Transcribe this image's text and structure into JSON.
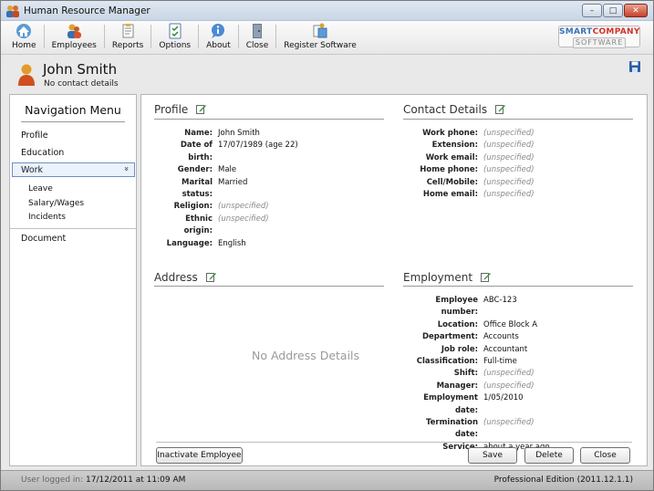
{
  "window": {
    "title": "Human Resource Manager",
    "minimize": "–",
    "maximize": "□",
    "close": "✕"
  },
  "toolbar": {
    "items": [
      {
        "label": "Home",
        "icon": "home-icon"
      },
      {
        "label": "Employees",
        "icon": "employees-icon"
      },
      {
        "label": "Reports",
        "icon": "reports-icon"
      },
      {
        "label": "Options",
        "icon": "options-icon"
      },
      {
        "label": "About",
        "icon": "about-icon"
      },
      {
        "label": "Close",
        "icon": "close-door-icon"
      },
      {
        "label": "Register Software",
        "icon": "register-icon"
      }
    ],
    "logo_smart": "SMART",
    "logo_company": "COMPANY",
    "logo_software": "SOFTWARE"
  },
  "person": {
    "name": "John Smith",
    "subtitle": "No contact details"
  },
  "nav": {
    "title": "Navigation Menu",
    "items": [
      "Profile",
      "Education",
      "Work",
      "Document"
    ],
    "selected": "Work",
    "sub_items": [
      "Leave",
      "Salary/Wages",
      "Incidents"
    ],
    "chevron": "»"
  },
  "profile": {
    "title": "Profile",
    "fields": [
      {
        "label": "Name:",
        "value": "John Smith"
      },
      {
        "label": "Date of birth:",
        "value": "17/07/1989 (age 22)"
      },
      {
        "label": "Gender:",
        "value": "Male"
      },
      {
        "label": "Marital status:",
        "value": "Married"
      },
      {
        "label": "Religion:",
        "value": "(unspecified)"
      },
      {
        "label": "Ethnic origin:",
        "value": "(unspecified)"
      },
      {
        "label": "Language:",
        "value": "English"
      }
    ]
  },
  "contact": {
    "title": "Contact Details",
    "fields": [
      {
        "label": "Work phone:",
        "value": "(unspecified)"
      },
      {
        "label": "Extension:",
        "value": "(unspecified)"
      },
      {
        "label": "Work email:",
        "value": "(unspecified)"
      },
      {
        "label": "Home phone:",
        "value": "(unspecified)"
      },
      {
        "label": "Cell/Mobile:",
        "value": "(unspecified)"
      },
      {
        "label": "Home email:",
        "value": "(unspecified)"
      }
    ]
  },
  "address": {
    "title": "Address",
    "empty_text": "No Address Details"
  },
  "employment": {
    "title": "Employment",
    "fields": [
      {
        "label": "Employee number:",
        "value": "ABC-123"
      },
      {
        "label": "Location:",
        "value": "Office Block A"
      },
      {
        "label": "Department:",
        "value": "Accounts"
      },
      {
        "label": "Job role:",
        "value": "Accountant"
      },
      {
        "label": "Classification:",
        "value": "Full-time"
      },
      {
        "label": "Shift:",
        "value": "(unspecified)"
      },
      {
        "label": "Manager:",
        "value": "(unspecified)"
      },
      {
        "label": "Employment date:",
        "value": "1/05/2010"
      },
      {
        "label": "Termination date:",
        "value": "(unspecified)"
      },
      {
        "label": "Service:",
        "value": "about a year ago"
      }
    ]
  },
  "buttons": {
    "inactivate": "Inactivate Employee",
    "save": "Save",
    "delete": "Delete",
    "close": "Close"
  },
  "status": {
    "user_label": "User logged in:",
    "user_value": "17/12/2011 at 11:09 AM",
    "edition": "Professional Edition (2011.12.1.1)"
  }
}
